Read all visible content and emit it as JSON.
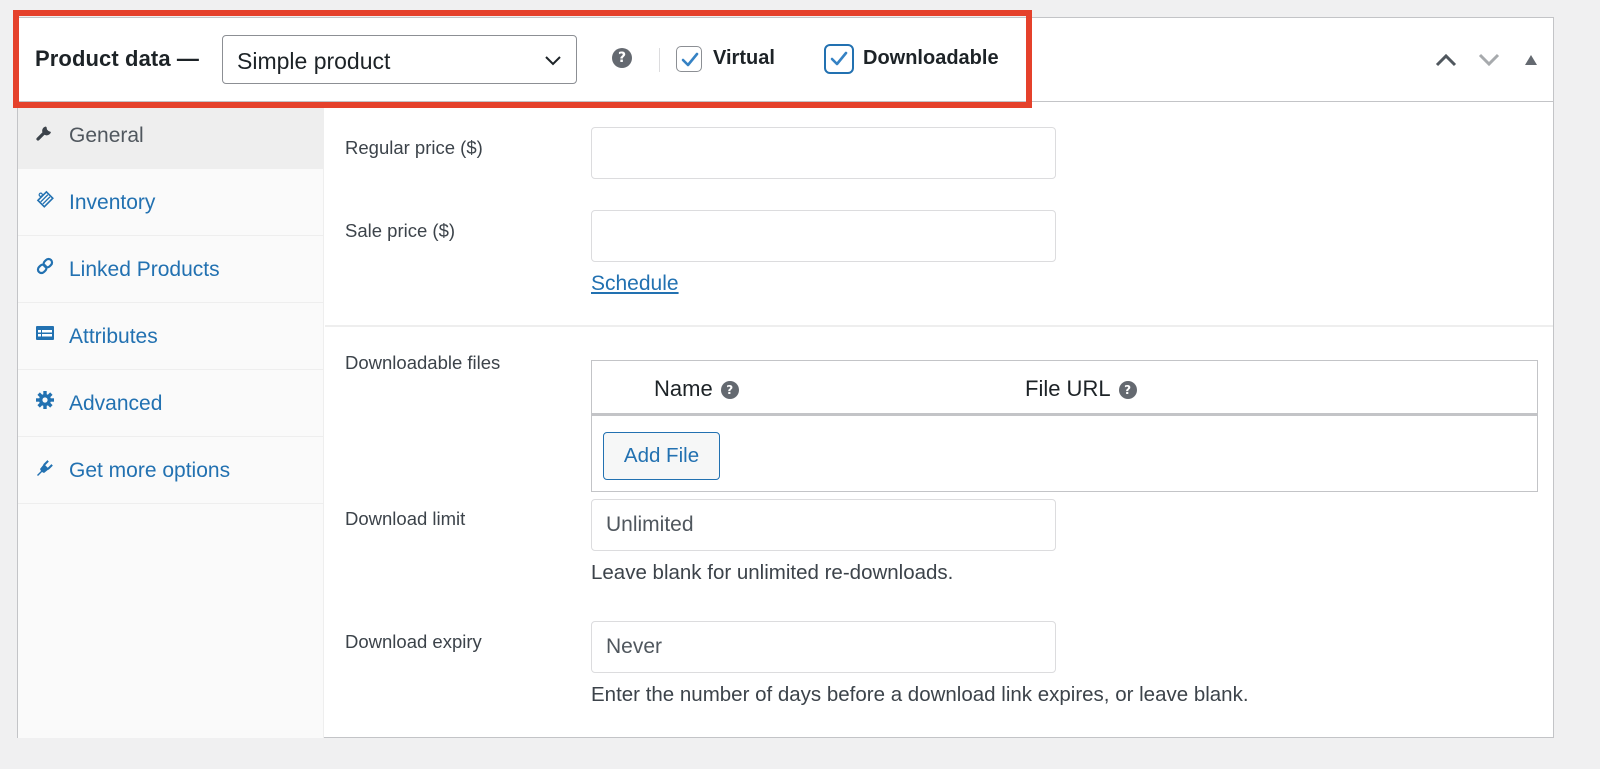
{
  "header": {
    "title": "Product data —",
    "product_type": {
      "selected": "Simple product"
    },
    "help_icon": "question-circle-icon",
    "checkboxes": [
      {
        "label": "Virtual",
        "checked": true
      },
      {
        "label": "Downloadable",
        "checked": true
      }
    ],
    "controls": [
      "chevron-up-icon",
      "chevron-down-icon",
      "triangle-up-icon"
    ]
  },
  "highlight_color": "#e5412b",
  "accent_color": "#2271b1",
  "sidebar": {
    "items": [
      {
        "label": "General",
        "icon": "wrench-icon",
        "active": true
      },
      {
        "label": "Inventory",
        "icon": "tag-icon",
        "active": false
      },
      {
        "label": "Linked Products",
        "icon": "link-icon",
        "active": false
      },
      {
        "label": "Attributes",
        "icon": "list-card-icon",
        "active": false
      },
      {
        "label": "Advanced",
        "icon": "gear-icon",
        "active": false
      },
      {
        "label": "Get more options",
        "icon": "plug-icon",
        "active": false
      }
    ]
  },
  "general": {
    "regular_price": {
      "label": "Regular price ($)",
      "value": "",
      "placeholder": ""
    },
    "sale_price": {
      "label": "Sale price ($)",
      "value": "",
      "placeholder": ""
    },
    "schedule_link": "Schedule",
    "downloadable_files": {
      "label": "Downloadable files",
      "columns": [
        "Name",
        "File URL"
      ],
      "add_button": "Add File"
    },
    "download_limit": {
      "label": "Download limit",
      "value": "",
      "placeholder": "Unlimited",
      "hint": "Leave blank for unlimited re-downloads."
    },
    "download_expiry": {
      "label": "Download expiry",
      "value": "",
      "placeholder": "Never",
      "hint": "Enter the number of days before a download link expires, or leave blank."
    }
  }
}
